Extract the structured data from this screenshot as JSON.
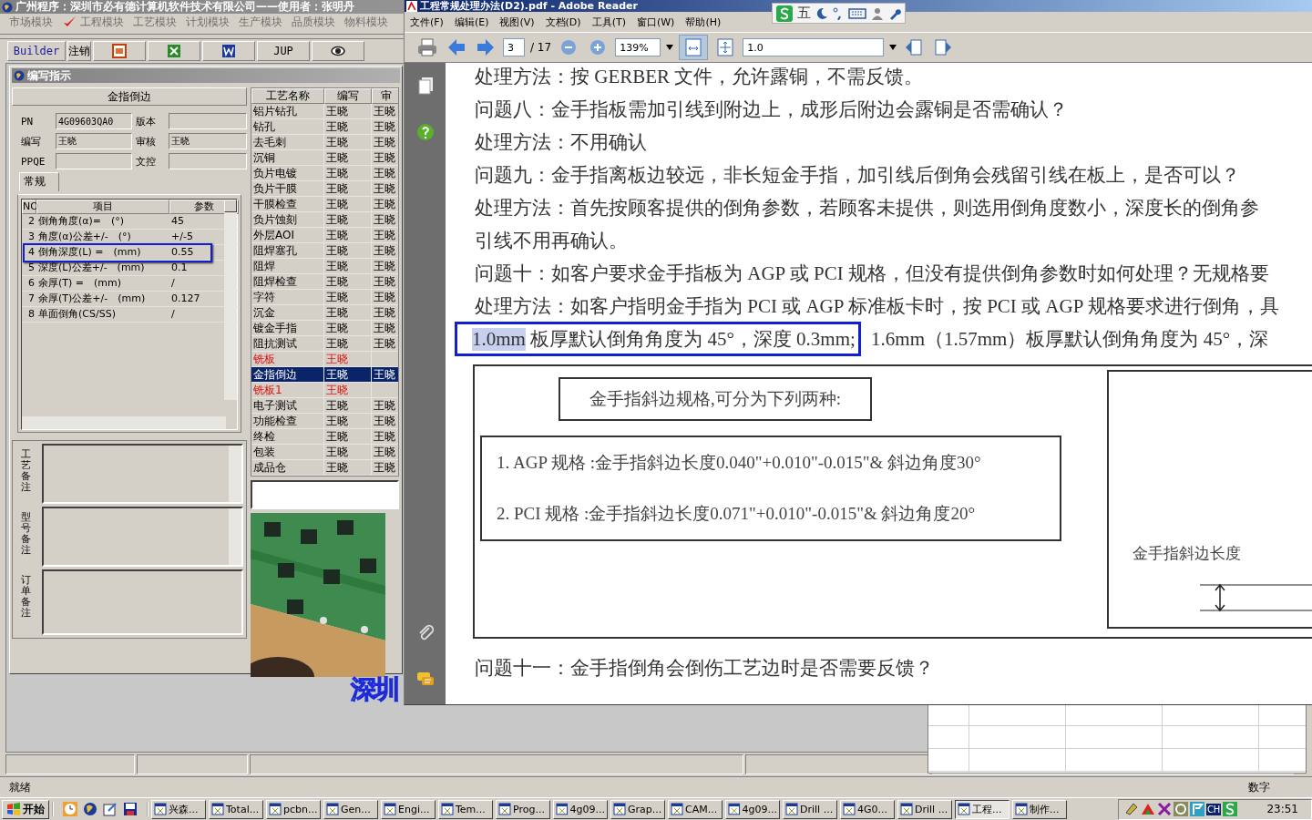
{
  "app": {
    "title": "广州程序：深圳市必有德计算机软件技术有限公司——使用者：张明丹",
    "modules": [
      {
        "label": "市场模块",
        "checked": false
      },
      {
        "label": "工程模块",
        "checked": true
      },
      {
        "label": "工艺模块",
        "checked": false
      },
      {
        "label": "计划模块",
        "checked": false
      },
      {
        "label": "生产模块",
        "checked": false
      },
      {
        "label": "品质模块",
        "checked": false
      },
      {
        "label": "物料模块",
        "checked": false
      }
    ],
    "toolbar": [
      "Builder",
      "注销",
      "JUP"
    ],
    "child": {
      "title": "编写指示",
      "header": "金指倒边",
      "fields": [
        {
          "label": "PN",
          "value": "4G09603QA0"
        },
        {
          "label": "版本"
        },
        {
          "label": "编写",
          "value": "王晓"
        },
        {
          "label": "审核",
          "value": "王晓"
        },
        {
          "label": "PPQE"
        },
        {
          "label": "文控"
        }
      ],
      "tab": "常规",
      "params": {
        "columns": [
          "NO",
          "项目",
          "参数"
        ],
        "rows": [
          {
            "no": "2",
            "item": "倒角角度(α)=　(°)",
            "value": "45",
            "annotated": false
          },
          {
            "no": "3",
            "item": "角度(α)公差+/-　(°)",
            "value": "+/-5",
            "annotated": false
          },
          {
            "no": "4",
            "item": "倒角深度(L) =　(mm)",
            "value": "0.55",
            "annotated": true
          },
          {
            "no": "5",
            "item": "深度(L)公差+/-　(mm)",
            "value": "0.1",
            "annotated": false
          },
          {
            "no": "6",
            "item": "余厚(T) =　(mm)",
            "value": "/",
            "annotated": false
          },
          {
            "no": "7",
            "item": "余厚(T)公差+/-　(mm)",
            "value": "0.127",
            "annotated": false
          },
          {
            "no": "8",
            "item": "单面倒角(CS/SS)",
            "value": "/",
            "annotated": false
          }
        ]
      },
      "memos": [
        "工艺备注",
        "型号备注",
        "订单备注"
      ],
      "process_table": {
        "columns": [
          "工艺名称",
          "编写",
          "审"
        ],
        "rows": [
          {
            "name": "铝片钻孔",
            "writer": "王晓",
            "reviewer": "王晓",
            "selected": false,
            "flagged": false
          },
          {
            "name": "钻孔",
            "writer": "王晓",
            "reviewer": "王晓",
            "selected": false,
            "flagged": false
          },
          {
            "name": "去毛刺",
            "writer": "王晓",
            "reviewer": "王晓",
            "selected": false,
            "flagged": false
          },
          {
            "name": "沉铜",
            "writer": "王晓",
            "reviewer": "王晓",
            "selected": false,
            "flagged": false
          },
          {
            "name": "负片电镀",
            "writer": "王晓",
            "reviewer": "王晓",
            "selected": false,
            "flagged": false
          },
          {
            "name": "负片干膜",
            "writer": "王晓",
            "reviewer": "王晓",
            "selected": false,
            "flagged": false
          },
          {
            "name": "干膜检查",
            "writer": "王晓",
            "reviewer": "王晓",
            "selected": false,
            "flagged": false
          },
          {
            "name": "负片蚀刻",
            "writer": "王晓",
            "reviewer": "王晓",
            "selected": false,
            "flagged": false
          },
          {
            "name": "外层AOI",
            "writer": "王晓",
            "reviewer": "王晓",
            "selected": false,
            "flagged": false
          },
          {
            "name": "阻焊塞孔",
            "writer": "王晓",
            "reviewer": "王晓",
            "selected": false,
            "flagged": false
          },
          {
            "name": "阻焊",
            "writer": "王晓",
            "reviewer": "王晓",
            "selected": false,
            "flagged": false
          },
          {
            "name": "阻焊检查",
            "writer": "王晓",
            "reviewer": "王晓",
            "selected": false,
            "flagged": false
          },
          {
            "name": "字符",
            "writer": "王晓",
            "reviewer": "王晓",
            "selected": false,
            "flagged": false
          },
          {
            "name": "沉金",
            "writer": "王晓",
            "reviewer": "王晓",
            "selected": false,
            "flagged": false
          },
          {
            "name": "镀金手指",
            "writer": "王晓",
            "reviewer": "王晓",
            "selected": false,
            "flagged": false
          },
          {
            "name": "阻抗测试",
            "writer": "王晓",
            "reviewer": "王晓",
            "selected": false,
            "flagged": false
          },
          {
            "name": "铣板",
            "writer": "王晓",
            "selected": false,
            "flagged": true
          },
          {
            "name": "金指倒边",
            "writer": "王晓",
            "reviewer": "王晓",
            "selected": true,
            "flagged": false
          },
          {
            "name": "铣板1",
            "writer": "王晓",
            "selected": false,
            "flagged": true
          },
          {
            "name": "电子测试",
            "writer": "王晓",
            "reviewer": "王晓",
            "selected": false,
            "flagged": false
          },
          {
            "name": "功能检查",
            "writer": "王晓",
            "reviewer": "王晓",
            "selected": false,
            "flagged": false
          },
          {
            "name": "终检",
            "writer": "王晓",
            "reviewer": "王晓",
            "selected": false,
            "flagged": false
          },
          {
            "name": "包装",
            "writer": "王晓",
            "reviewer": "王晓",
            "selected": false,
            "flagged": false
          },
          {
            "name": "成品仓",
            "writer": "王晓",
            "reviewer": "王晓",
            "selected": false,
            "flagged": false
          }
        ]
      }
    },
    "backdrop_text": "深圳",
    "status": {
      "text": "就绪",
      "indicator": "数字"
    }
  },
  "reader": {
    "title": "工程常规处理办法(D2).pdf - Adobe Reader",
    "menus": [
      "文件(F)",
      "编辑(E)",
      "视图(V)",
      "文档(D)",
      "工具(T)",
      "窗口(W)",
      "帮助(H)"
    ],
    "ime_mode": "五",
    "page": "3",
    "page_count": "/ 17",
    "zoom": "139%",
    "magnifier": "1.0",
    "lines": [
      {
        "kind": "plain",
        "text": "处理方法：按 GERBER 文件，允许露铜，不需反馈。"
      },
      {
        "kind": "plain",
        "text": "问题八：金手指板需加引线到附边上，成形后附边会露铜是否需确认？"
      },
      {
        "kind": "plain",
        "text": "处理方法：不用确认"
      },
      {
        "kind": "plain",
        "text": "问题九：金手指离板边较远，非长短金手指，加引线后倒角会残留引线在板上，是否可以？"
      },
      {
        "kind": "plain",
        "text": "处理方法：首先按顾客提供的倒角参数，若顾客未提供，则选用倒角度数小，深度长的倒角参"
      },
      {
        "kind": "plain",
        "text": "引线不用再确认。"
      },
      {
        "kind": "plain",
        "text": "问题十：如客户要求金手指板为 AGP 或 PCI 规格，但没有提供倒角参数时如何处理？无规格要"
      },
      {
        "kind": "plain",
        "text": "处理方法：如客户指明金手指为 PCI 或 AGP 标准板卡时，按 PCI 或 AGP 规格要求进行倒角，具"
      },
      {
        "kind": "segments",
        "segments": [
          {
            "text": "1.0mm",
            "selected": true,
            "framed": true
          },
          {
            "text": " 板厚默认倒角角度为 45°，深度 0.3mm;",
            "selected": false,
            "framed": true
          },
          {
            "text": " 1.6mm（1.57mm）板厚默认倒角角度为 45°，深",
            "selected": false,
            "framed": false
          }
        ]
      }
    ],
    "figure": {
      "title": "金手指斜边规格,可分为下列两种:",
      "specs": [
        "1. AGP 规格 :金手指斜边长度0.040\"+0.010\"-0.015\"& 斜边角度30°",
        "2.  PCI 规格 :金手指斜边长度0.071\"+0.010\"-0.015\"& 斜边角度20°"
      ],
      "diagram_label": "金手指斜边长度"
    },
    "lines_after": [
      {
        "kind": "plain",
        "text": "问题十一：金手指倒角会倒伤工艺边时是否需要反馈？"
      }
    ]
  },
  "taskbar": {
    "start": "开始",
    "tasks": [
      {
        "label": "兴森...",
        "active": false
      },
      {
        "label": "Total...",
        "active": false
      },
      {
        "label": "pcbn...",
        "active": false
      },
      {
        "label": "Gen...",
        "active": false
      },
      {
        "label": "Engi...",
        "active": false
      },
      {
        "label": "Tem...",
        "active": false
      },
      {
        "label": "Prog...",
        "active": false
      },
      {
        "label": "4g09...",
        "active": false
      },
      {
        "label": "Grap...",
        "active": false
      },
      {
        "label": "CAM...",
        "active": false
      },
      {
        "label": "4g09...",
        "active": false
      },
      {
        "label": "Drill ...",
        "active": false
      },
      {
        "label": "4G0...",
        "active": false
      },
      {
        "label": "Drill ...",
        "active": false
      },
      {
        "label": "工程...",
        "active": true
      },
      {
        "label": "制作...",
        "active": false
      }
    ],
    "language": "CH",
    "clock": "23:51"
  }
}
